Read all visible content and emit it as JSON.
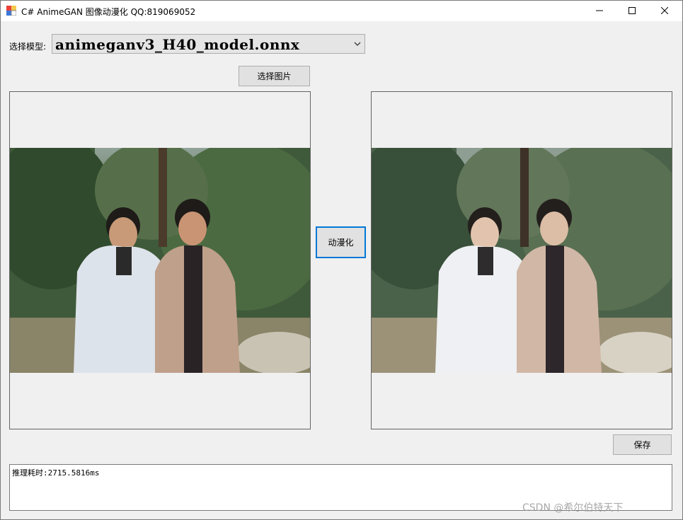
{
  "window": {
    "title": "C# AnimeGAN 图像动漫化 QQ:819069052",
    "minimize_icon": "minimize-icon",
    "maximize_icon": "maximize-icon",
    "close_icon": "close-icon"
  },
  "model": {
    "label": "选择模型:",
    "selected": "animeganv3_H40_model.onnx"
  },
  "buttons": {
    "select_image": "选择图片",
    "convert": "动漫化",
    "save": "保存"
  },
  "images": {
    "left_icon": "photo-original",
    "right_icon": "photo-anime"
  },
  "output": {
    "text": "推理耗时:2715.5816ms"
  },
  "watermark": "CSDN @希尔伯特天下"
}
